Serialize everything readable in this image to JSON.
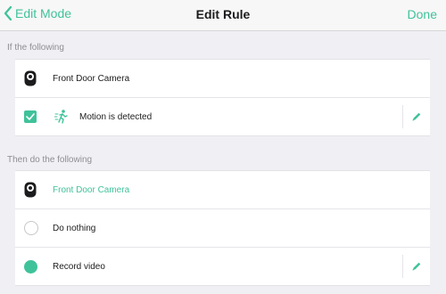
{
  "nav": {
    "back_label": "Edit Mode",
    "title": "Edit Rule",
    "done_label": "Done"
  },
  "trigger_section": {
    "header": "If the following",
    "device_name": "Front Door Camera",
    "condition_label": "Motion is detected",
    "condition_checked": true
  },
  "action_section": {
    "header": "Then do the following",
    "device_name": "Front Door Camera",
    "options": [
      {
        "label": "Do nothing",
        "selected": false
      },
      {
        "label": "Record video",
        "selected": true
      }
    ]
  },
  "icons": {
    "back": "chevron-left-icon",
    "camera": "camera-icon",
    "check": "checkmark-icon",
    "motion": "motion-person-icon",
    "edit": "pencil-icon"
  },
  "colors": {
    "accent": "#3fc29a",
    "background": "#efeff4",
    "text": "#1c1c1e",
    "secondary_text": "#8e8e93"
  }
}
